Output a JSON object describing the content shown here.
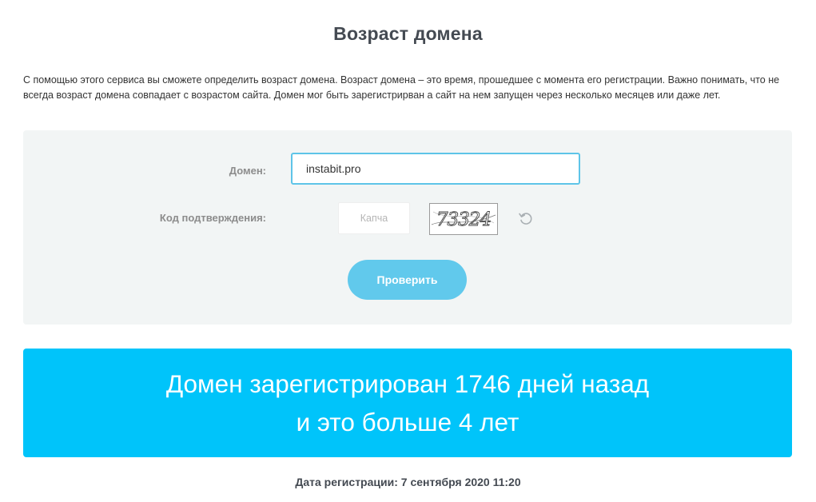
{
  "page": {
    "title": "Возраст домена",
    "description": "С помощью этого сервиса вы сможете определить возраст домена. Возраст домена – это время, прошедшее с момента его регистрации. Важно понимать, что не всегда возраст домена совпадает с возрастом сайта. Домен мог быть зарегистрирван а сайт на нем запущен через несколько месяцев или даже лет."
  },
  "form": {
    "domain_label": "Домен:",
    "domain_value": "instabit.pro",
    "code_label": "Код подтверждения:",
    "captcha_placeholder": "Капча",
    "captcha_text": "73324",
    "submit_label": "Проверить"
  },
  "result": {
    "line1": "Домен зарегистрирован 1746 дней назад",
    "line2": "и это больше 4 лет",
    "registration_date": "Дата регистрации: 7 сентября 2020 11:20"
  },
  "icons": {
    "refresh": "refresh-icon"
  },
  "colors": {
    "accent": "#00c4fa",
    "button": "#61c9ec",
    "input_border": "#5ec4e8",
    "panel_bg": "#f2f5f5",
    "title": "#444a52"
  }
}
